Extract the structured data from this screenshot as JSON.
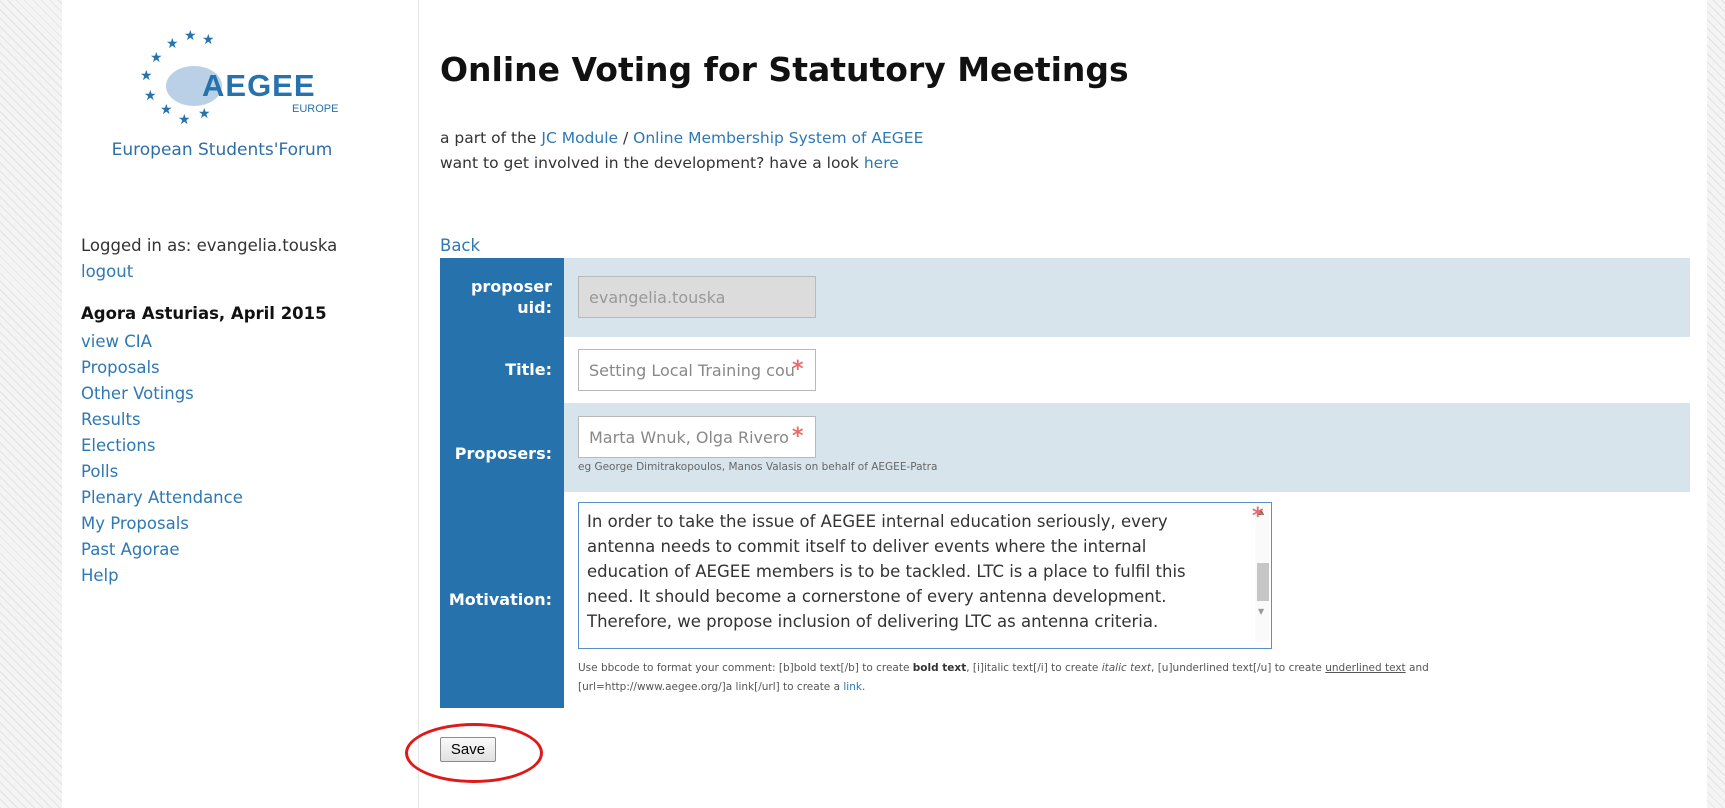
{
  "brand": {
    "logo_text": "AEGEE",
    "logo_subtext": "EUROPE",
    "tagline": "European Students'Forum",
    "colors": {
      "blue": "#2672ad",
      "link": "#2e78b4",
      "row_shade": "#d7e4ec",
      "required": "#e86c6c",
      "highlight": "#e01818"
    }
  },
  "sidebar": {
    "logged_in": "Logged in as: evangelia.touska",
    "logout": "logout",
    "event": "Agora Asturias, April 2015",
    "nav": [
      "view CIA",
      "Proposals",
      "Other Votings",
      "Results",
      "Elections",
      "Polls",
      "Plenary Attendance",
      "My Proposals",
      "Past Agorae",
      "Help"
    ]
  },
  "main": {
    "title": "Online Voting for Statutory Meetings",
    "intro_prefix": "a part of the ",
    "intro_link1": "JC Module",
    "intro_sep": " / ",
    "intro_link2": "Online Membership System of AEGEE",
    "intro_line2": "want to get involved in the development? have a look ",
    "intro_link3": "here",
    "back": "Back"
  },
  "form": {
    "proposer_label": "proposer uid:",
    "proposer_value": "evangelia.touska",
    "title_label": "Title:",
    "title_value": "Setting Local Training cou",
    "proposers_label": "Proposers:",
    "proposers_value": "Marta Wnuk, Olga Rivero",
    "proposers_hint": "eg George Dimitrakopoulos, Manos Valasis on behalf of AEGEE-Patra",
    "motivation_label": "Motivation:",
    "motivation_value": "In order to take the issue of AEGEE internal education seriously, every antenna needs to commit itself to deliver events where the internal education of AEGEE members is to be tackled. LTC is a place to fulfil this need. It should become a cornerstone of every antenna development. Therefore, we propose inclusion of delivering LTC as antenna criteria.",
    "bbcode_1": "Use bbcode to format your comment: [b]bold text[/b] to create ",
    "bbcode_bold": "bold text",
    "bbcode_2": ", [i]italic text[/i] to create ",
    "bbcode_italic": "italic text",
    "bbcode_3": ", [u]underlined text[/u] to create ",
    "bbcode_underline": "underlined text",
    "bbcode_4": " and",
    "bbcode_5": "[url=http://www.aegee.org/]a link[/url] to create a ",
    "bbcode_link": "link",
    "bbcode_6": ".",
    "required_mark": "*",
    "save": "Save"
  }
}
